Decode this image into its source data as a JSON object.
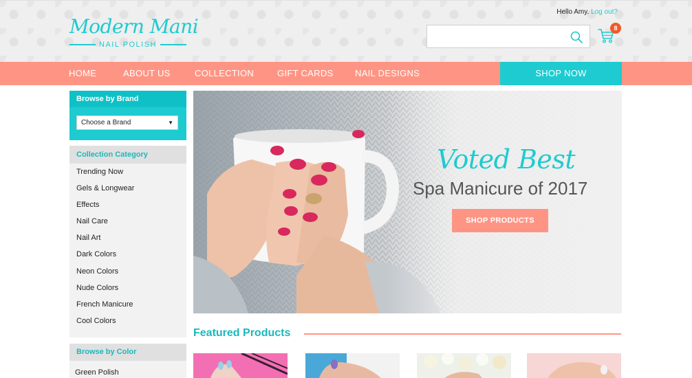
{
  "header": {
    "logo_script": "Modern Mani",
    "logo_sub": "NAIL POLISH",
    "greeting": "Hello Amy.",
    "logout_label": "Log out?",
    "search_placeholder": "",
    "cart_count": "8",
    "icons": [
      "search-icon",
      "cart-icon"
    ]
  },
  "nav": {
    "items": [
      {
        "label": "HOME"
      },
      {
        "label": "ABOUT US"
      },
      {
        "label": "COLLECTION"
      },
      {
        "label": "GIFT CARDS"
      },
      {
        "label": "NAIL DESIGNS"
      }
    ],
    "shop_now": "SHOP NOW"
  },
  "sidebar": {
    "brand": {
      "heading": "Browse by Brand",
      "selected": "Choose a Brand"
    },
    "category": {
      "heading": "Collection Category",
      "items": [
        "Trending Now",
        "Gels & Longwear",
        "Effects",
        "Nail Care",
        "Nail Art",
        "Dark Colors",
        "Neon Colors",
        "Nude Colors",
        "French Manicure",
        "Cool Colors"
      ]
    },
    "color": {
      "heading": "Browse by Color",
      "items": [
        "Green Polish"
      ]
    }
  },
  "hero": {
    "script": "Voted Best",
    "subtitle": "Spa Manicure of 2017",
    "button": "SHOP PRODUCTS"
  },
  "featured": {
    "title": "Featured Products"
  },
  "colors": {
    "teal": "#1ecbd0",
    "coral": "#fe9584",
    "badge": "#f15a29"
  }
}
